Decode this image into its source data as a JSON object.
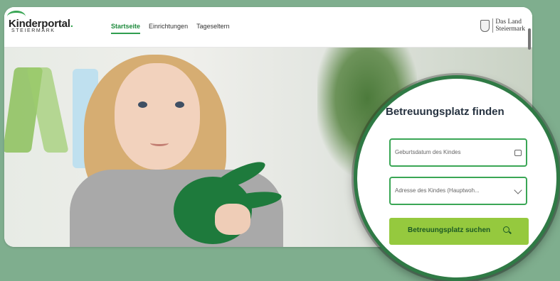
{
  "header": {
    "logo_main": "Kinderportal",
    "logo_dot": ".",
    "logo_sub": "STEIERMARK",
    "nav": [
      "Startseite",
      "Einrichtungen",
      "Tageseltern"
    ],
    "land_line1": "Das Land",
    "land_line2": "Steiermark"
  },
  "search_widget": {
    "title": "Betreuungsplatz finden",
    "birthdate_placeholder": "Geburtsdatum des Kindes",
    "address_placeholder": "Adresse des Kindes (Hauptwoh...",
    "submit_label": "Betreuungsplatz suchen"
  },
  "colors": {
    "accent": "#2f9e4f",
    "button": "#95c93e",
    "background": "#7fae8e"
  }
}
